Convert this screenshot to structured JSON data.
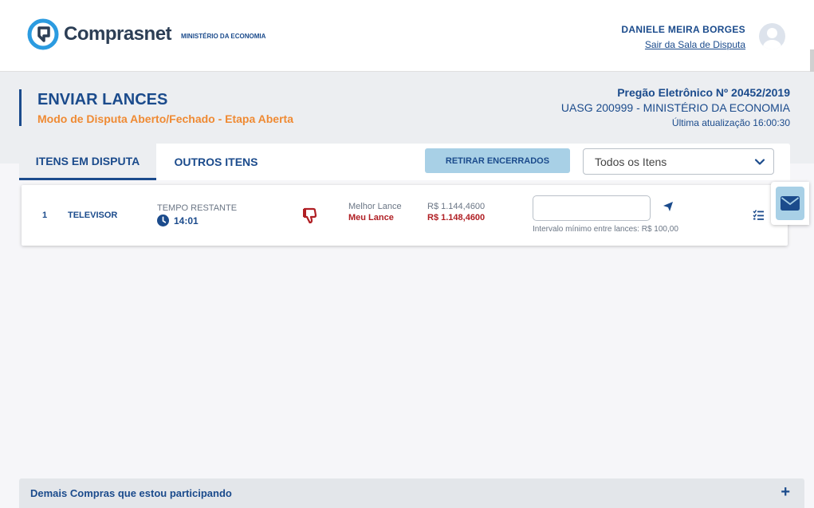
{
  "header": {
    "brand": "Comprasnet",
    "ministry": "MINISTÉRIO DA ECONOMIA",
    "user_name": "DANIELE MEIRA BORGES",
    "exit_link": "Sair da Sala de Disputa"
  },
  "page": {
    "title": "ENVIAR LANCES",
    "subtitle": "Modo de Disputa Aberto/Fechado - Etapa Aberta",
    "pregao": "Pregão Eletrônico Nº 20452/2019",
    "uasg": "UASG 200999 - MINISTÉRIO DA ECONOMIA",
    "updated": "Última atualização 16:00:30"
  },
  "tabs": [
    {
      "label": "ITENS EM DISPUTA",
      "active": true
    },
    {
      "label": "OUTROS ITENS",
      "active": false
    }
  ],
  "toolbar": {
    "retirar_label": "RETIRAR ENCERRADOS",
    "filter_value": "Todos os Itens"
  },
  "items": [
    {
      "number": "1",
      "name": "TELEVISOR",
      "time_label": "TEMPO RESTANTE",
      "time_value": "14:01",
      "best_label": "Melhor Lance",
      "mine_label": "Meu Lance",
      "best_value": "R$ 1.144,4600",
      "mine_value": "R$ 1.148,4600",
      "bid_value": "",
      "interval_text": "Intervalo mínimo entre lances: R$ 100,00"
    }
  ],
  "footer": {
    "label": "Demais Compras que estou participando",
    "plus": "+"
  },
  "colors": {
    "primary": "#1b4b8c",
    "accent_orange": "#ef8a33",
    "danger": "#b01f24",
    "light_blue": "#a8d0e6"
  },
  "icons": [
    "comprasnet-logo-icon",
    "user-avatar-icon",
    "chevron-down-icon",
    "clock-icon",
    "thumbs-down-icon",
    "send-icon",
    "list-check-icon",
    "mail-icon"
  ]
}
